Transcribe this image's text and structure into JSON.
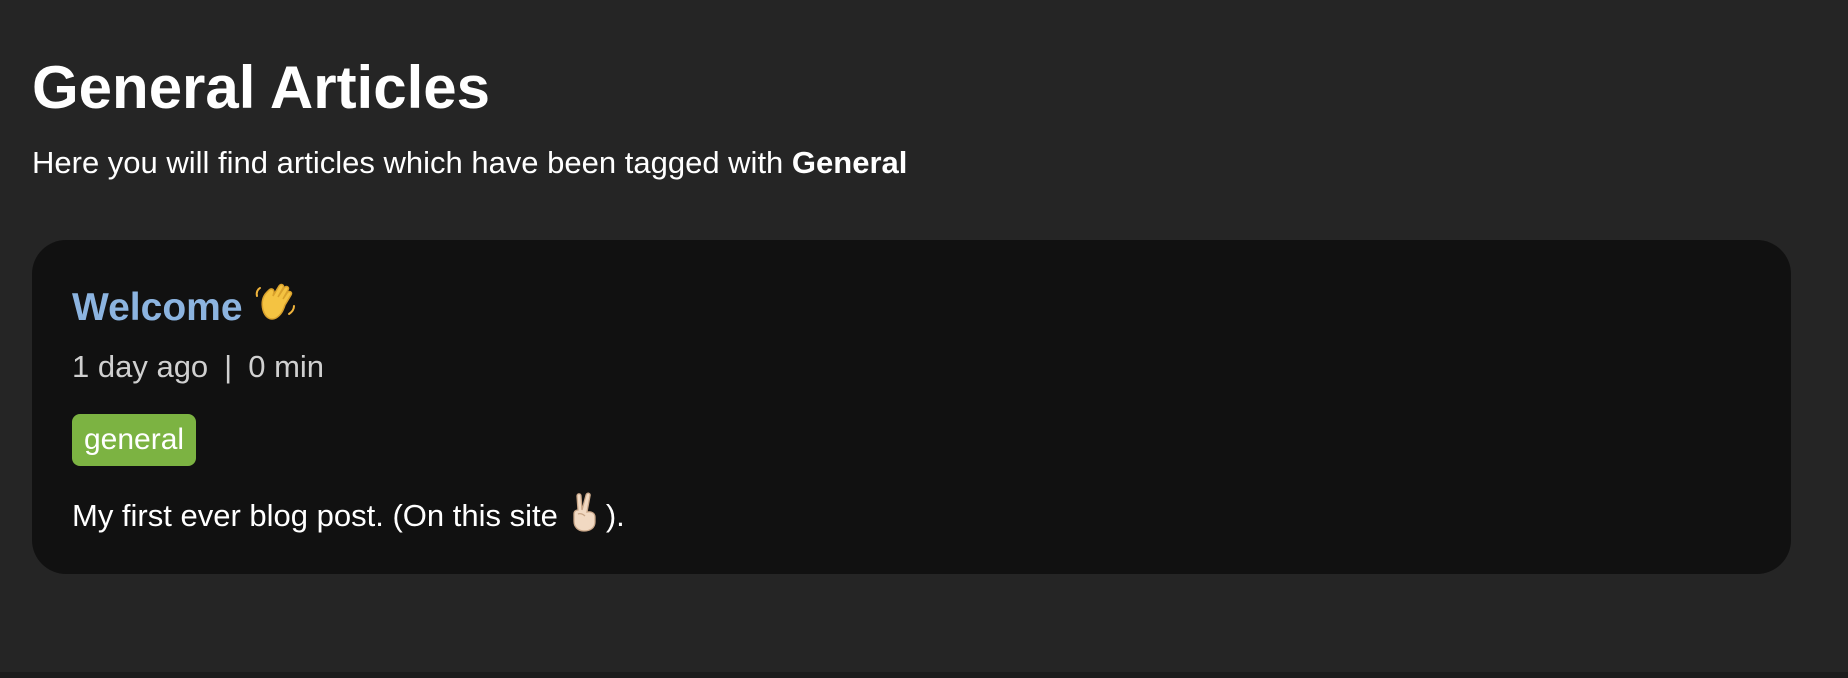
{
  "page": {
    "title": "General Articles",
    "intro_text": "Here you will find articles which have been tagged with ",
    "intro_tag": "General"
  },
  "articles": [
    {
      "title": "Welcome",
      "title_icon": "waving-hand-icon",
      "date": "1 day ago",
      "separator": "|",
      "read_time": "0 min",
      "tag": "general",
      "excerpt_before": "My first ever blog post. (On this site",
      "excerpt_icon": "victory-hand-icon",
      "excerpt_after": ")."
    }
  ],
  "colors": {
    "background": "#252525",
    "card_background": "#111111",
    "title_link": "#8cb4e0",
    "tag_chip": "#7cb342",
    "meta_text": "#d0d0d0"
  }
}
